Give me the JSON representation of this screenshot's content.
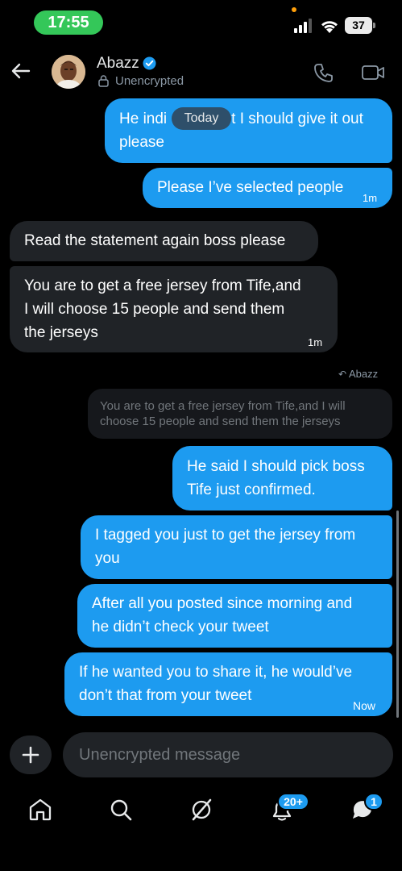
{
  "status_bar": {
    "time": "17:55",
    "battery": "37"
  },
  "header": {
    "contact_name": "Abazz",
    "encryption_status": "Unencrypted"
  },
  "conversation": {
    "date_chip": "Today",
    "messages": [
      {
        "direction": "sent",
        "text_line1": "He indi",
        "text_line1b": "t I should give it out",
        "text_line2": "please",
        "time": ""
      },
      {
        "direction": "sent",
        "text": "Please I’ve selected people",
        "time": "1m"
      },
      {
        "direction": "received",
        "text": "Read the statement again boss please",
        "time": ""
      },
      {
        "direction": "received",
        "lines": [
          "You are to get a free jersey from Tife,and",
          "I will choose 15 people and send them",
          "the jerseys"
        ],
        "time": "1m"
      },
      {
        "direction": "sent",
        "lines": [
          "He said I should pick boss",
          "Tife just confirmed."
        ],
        "time": ""
      },
      {
        "direction": "sent",
        "lines": [
          "I tagged you just to get the jersey from",
          "you"
        ],
        "time": ""
      },
      {
        "direction": "sent",
        "lines": [
          "After all you posted since morning and",
          "he didn’t check your tweet"
        ],
        "time": ""
      },
      {
        "direction": "sent",
        "lines": [
          "If he wanted you to share it, he would’ve",
          "don’t that from your tweet"
        ],
        "time": "Now"
      }
    ],
    "reply": {
      "label": "Abazz",
      "quoted_lines": [
        "You are to get a free jersey from Tife,and I will",
        "choose 15 people and send them the jerseys"
      ]
    }
  },
  "composer": {
    "placeholder": "Unencrypted message"
  },
  "bottom_nav": {
    "items": [
      "home-icon",
      "search-icon",
      "grok-icon",
      "notifications-icon",
      "messages-icon"
    ],
    "notifications_badge": "20+",
    "messages_badge": "1"
  },
  "colors": {
    "accent": "#1d9bf0",
    "received_bubble": "#202327",
    "background": "#000000",
    "time_pill": "#34c759"
  }
}
